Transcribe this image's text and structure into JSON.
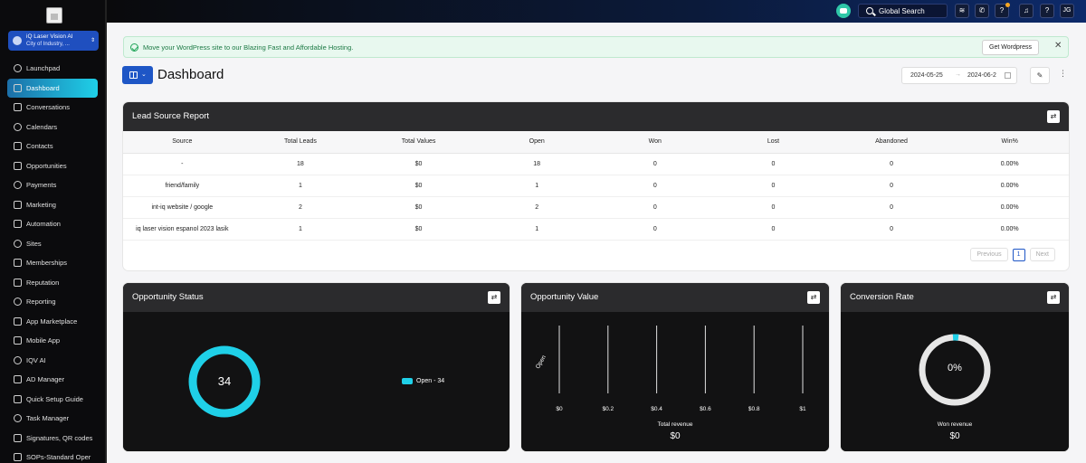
{
  "account": {
    "name": "iQ Laser Vision AI",
    "location": "City of Industry, ..."
  },
  "sidebar": {
    "items": [
      {
        "label": "Launchpad",
        "icon": "rocket-icon"
      },
      {
        "label": "Dashboard",
        "icon": "dashboard-icon",
        "active": true
      },
      {
        "label": "Conversations",
        "icon": "chat-icon"
      },
      {
        "label": "Calendars",
        "icon": "calendar-icon"
      },
      {
        "label": "Contacts",
        "icon": "contacts-icon"
      },
      {
        "label": "Opportunities",
        "icon": "opportunities-icon"
      },
      {
        "label": "Payments",
        "icon": "payments-icon"
      },
      {
        "label": "Marketing",
        "icon": "marketing-icon"
      },
      {
        "label": "Automation",
        "icon": "automation-icon"
      },
      {
        "label": "Sites",
        "icon": "globe-icon"
      },
      {
        "label": "Memberships",
        "icon": "memberships-icon"
      },
      {
        "label": "Reputation",
        "icon": "reputation-icon"
      },
      {
        "label": "Reporting",
        "icon": "reporting-icon"
      },
      {
        "label": "App Marketplace",
        "icon": "marketplace-icon"
      },
      {
        "label": "Mobile App",
        "icon": "mobile-icon"
      },
      {
        "label": "IQV AI",
        "icon": "ai-icon"
      },
      {
        "label": "AD Manager",
        "icon": "ad-manager-icon"
      },
      {
        "label": "Quick Setup Guide",
        "icon": "guide-icon"
      },
      {
        "label": "Task Manager",
        "icon": "task-icon"
      },
      {
        "label": "Signatures, QR codes",
        "icon": "signature-icon"
      },
      {
        "label": "SOPs-Standard Oper",
        "icon": "sop-icon"
      }
    ]
  },
  "topbar": {
    "search_label": "Global Search",
    "avatar": "JG"
  },
  "banner": {
    "message": "Move your WordPress site to our Blazing Fast and Affordable Hosting.",
    "button": "Get Wordpress"
  },
  "header": {
    "title": "Dashboard",
    "date_start": "2024-05-25",
    "date_end": "2024-06-2"
  },
  "lead_report": {
    "title": "Lead Source Report",
    "columns": [
      "Source",
      "Total Leads",
      "Total Values",
      "Open",
      "Won",
      "Lost",
      "Abandoned",
      "Win%"
    ],
    "rows": [
      [
        "-",
        "18",
        "$0",
        "18",
        "0",
        "0",
        "0",
        "0.00%"
      ],
      [
        "friend/family",
        "1",
        "$0",
        "1",
        "0",
        "0",
        "0",
        "0.00%"
      ],
      [
        "int-iq website / google",
        "2",
        "$0",
        "2",
        "0",
        "0",
        "0",
        "0.00%"
      ],
      [
        "iq laser vision espanol 2023 lasik",
        "1",
        "$0",
        "1",
        "0",
        "0",
        "0",
        "0.00%"
      ]
    ],
    "pager": {
      "prev": "Previous",
      "page": "1",
      "next": "Next"
    }
  },
  "opportunity_status": {
    "title": "Opportunity Status",
    "total": "34",
    "legend": "Open - 34"
  },
  "opportunity_value": {
    "title": "Opportunity Value",
    "ylabel": "Open",
    "xlabel": "Total revenue",
    "total": "$0"
  },
  "conversion_rate": {
    "title": "Conversion Rate",
    "value": "0%",
    "label": "Won revenue",
    "total": "$0"
  },
  "chart_data": [
    {
      "type": "pie",
      "labels": [
        "Open"
      ],
      "values": [
        34
      ],
      "title": "Opportunity Status",
      "legend": "right"
    },
    {
      "type": "bar",
      "title": "Opportunity Value",
      "categories": [
        "Open"
      ],
      "values": [
        0
      ],
      "ylabel": "Open",
      "xlabel": "Total revenue",
      "xticks": [
        "$0",
        "$0.2",
        "$0.4",
        "$0.6",
        "$0.8",
        "$1"
      ],
      "xlim": [
        0,
        1
      ],
      "grid": true
    },
    {
      "type": "pie",
      "title": "Conversion Rate",
      "labels": [
        "Won"
      ],
      "values": [
        0
      ]
    }
  ],
  "colors": {
    "accent": "#1fd0e8",
    "primary": "#1e56c6",
    "dark": "#2b2b2d"
  }
}
